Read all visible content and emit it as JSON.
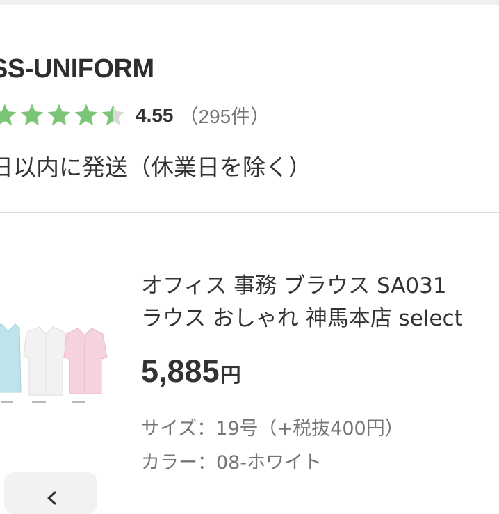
{
  "shop": {
    "name": "SS-UNIFORM",
    "rating_value": "4.55",
    "rating_stars": 4.5,
    "review_count": "（295件）",
    "star_color": "#7cc576",
    "star_empty_color": "#d9d9d9"
  },
  "shipping": {
    "text": "日以内に発送（休業日を除く）"
  },
  "product": {
    "title_line1": "オフィス 事務 ブラウス SA031",
    "title_line2": "ラウス おしゃれ 神馬本店 select",
    "price_value": "5,885",
    "price_unit": "円",
    "size_label": "サイズ：19号（+税抜400円）",
    "color_label": "カラー：08-ホワイト",
    "image_icon": "blouse-thumbnail-image",
    "shirt_colors": [
      "#bfe3ea",
      "#f2f2f2",
      "#f6d2dc"
    ]
  },
  "nav": {
    "back_icon": "chevron-left-icon"
  }
}
